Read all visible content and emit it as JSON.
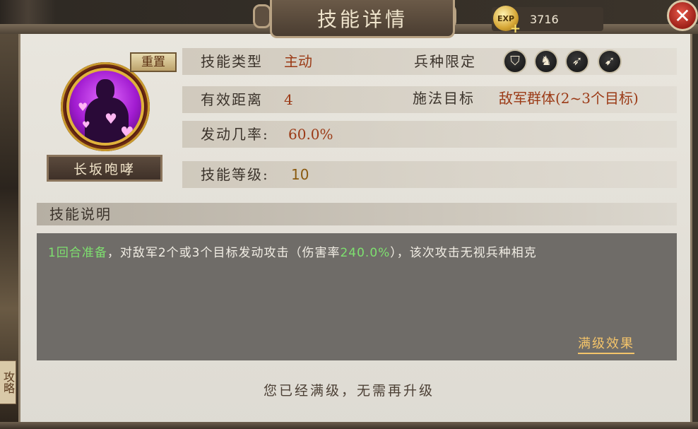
{
  "header": {
    "title": "技能详情",
    "exp_icon_label": "EXP",
    "exp_value": "3716",
    "close_glyph": "✕"
  },
  "side": {
    "label": "攻略"
  },
  "skill": {
    "name": "长坂咆哮",
    "reset_label": "重置",
    "portrait_icon": "purple-silhouette-with-hearts"
  },
  "info": {
    "type_label": "技能类型",
    "type_value": "主动",
    "troop_label": "兵种限定",
    "troop_icons": [
      "shield-icon",
      "horse-icon",
      "spear-icon",
      "bow-icon"
    ],
    "range_label": "有效距离",
    "range_value": "4",
    "target_label": "施法目标",
    "target_value": "敌军群体(2~3个目标)",
    "chance_label": "发动几率:",
    "chance_value": "60.0%",
    "level_label": "技能等级:",
    "level_value": "10"
  },
  "description": {
    "header": "技能说明",
    "part1": "1回合准备",
    "part2": "，对敌军2个或3个目标发动攻击（伤害率",
    "part3": "240.0%",
    "part4": "），该次攻击无视兵种相克",
    "full_effect_link": "满级效果"
  },
  "footer": {
    "message": "您已经满级，无需再升级"
  },
  "colors": {
    "accent_red": "#9b3a16",
    "highlight_green": "#7ee06f",
    "link_gold": "#f4c46a"
  }
}
